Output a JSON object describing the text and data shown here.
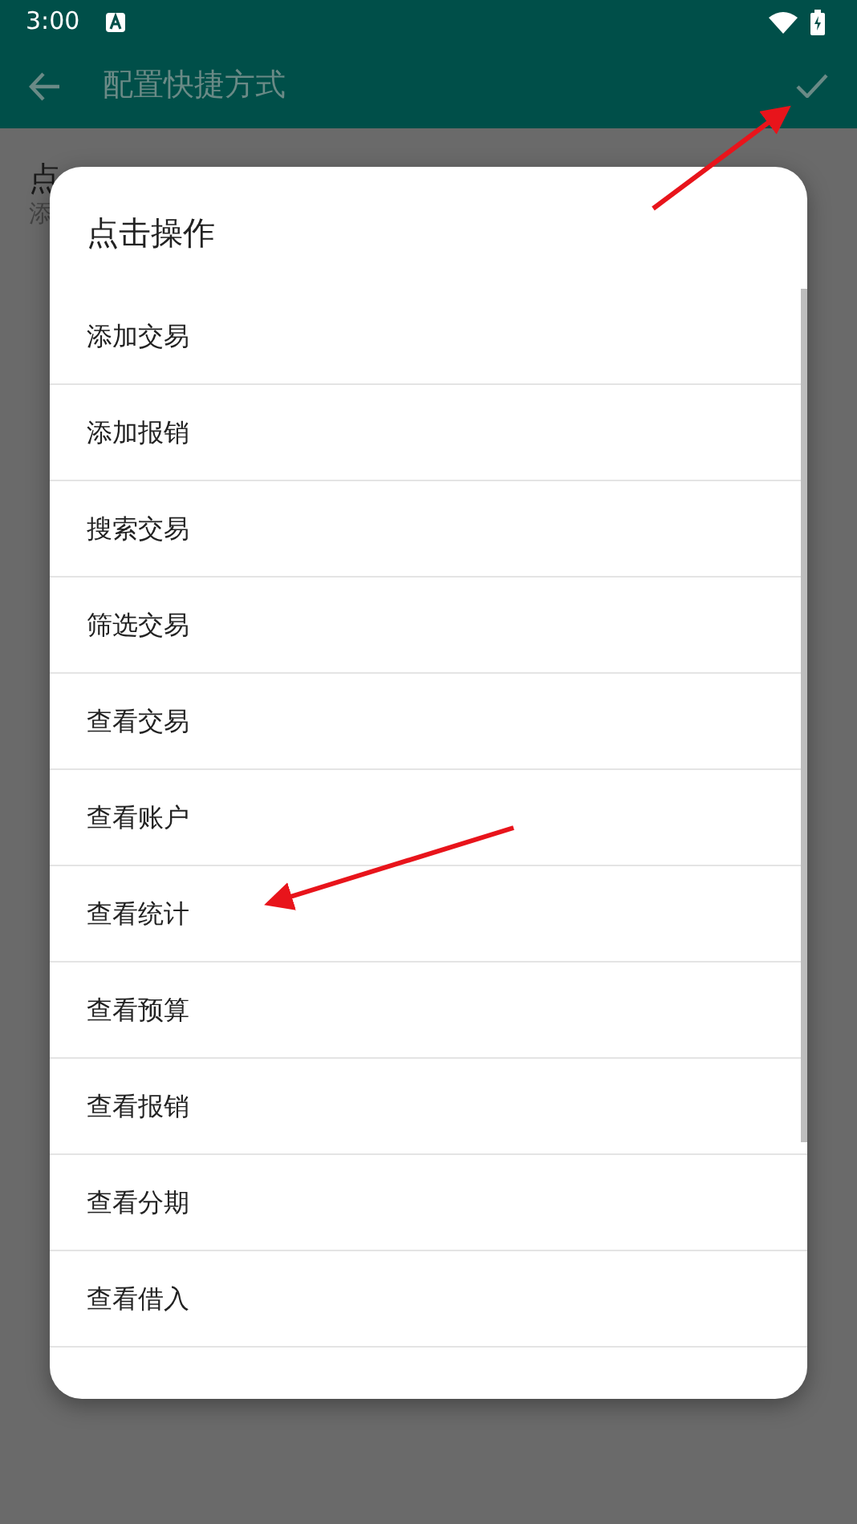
{
  "status_bar": {
    "time": "3:00"
  },
  "app_bar": {
    "title": "配置快捷方式"
  },
  "behind_dialog": {
    "title": "点",
    "subtitle": "添"
  },
  "dialog": {
    "title": "点击操作",
    "items": [
      {
        "label": "添加交易"
      },
      {
        "label": "添加报销"
      },
      {
        "label": "搜索交易"
      },
      {
        "label": "筛选交易"
      },
      {
        "label": "查看交易"
      },
      {
        "label": "查看账户"
      },
      {
        "label": "查看统计"
      },
      {
        "label": "查看预算"
      },
      {
        "label": "查看报销"
      },
      {
        "label": "查看分期"
      },
      {
        "label": "查看借入"
      }
    ]
  }
}
